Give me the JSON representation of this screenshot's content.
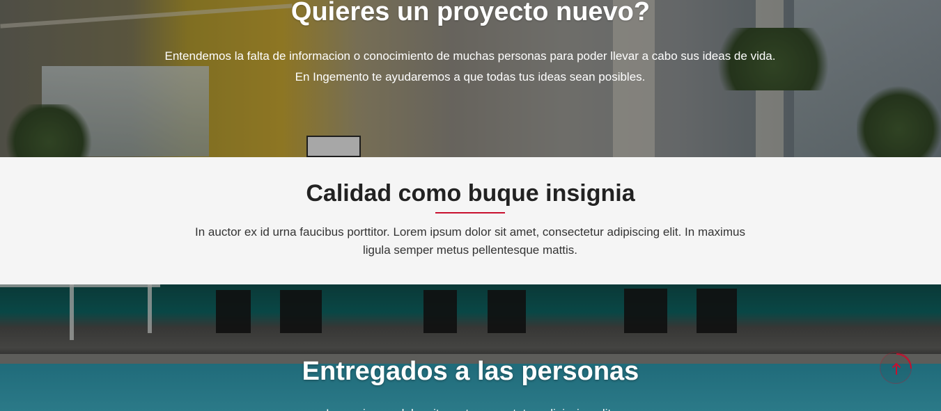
{
  "hero": {
    "title": "Quieres un proyecto nuevo?",
    "description": "Entendemos la falta de informacion o conocimiento de muchas personas para poder llevar a cabo sus ideas de vida. En Ingemento te ayudaremos a que todas tus ideas sean posibles."
  },
  "quality": {
    "title": "Calidad como buque insignia",
    "description": "In auctor ex id urna faucibus porttitor. Lorem ipsum dolor sit amet, consectetur adipiscing elit. In maximus ligula semper metus pellentesque mattis."
  },
  "pool": {
    "title": "Entregados a las personas",
    "description": "Lorem ipsum dolor sit amet, consectetur adipiscing elit."
  },
  "scroll_top": {
    "icon": "arrow-up-icon",
    "color": "#c8102e"
  },
  "colors": {
    "accent": "#c8102e",
    "section_bg": "#f5f5f5",
    "heading_dark": "#222222"
  }
}
